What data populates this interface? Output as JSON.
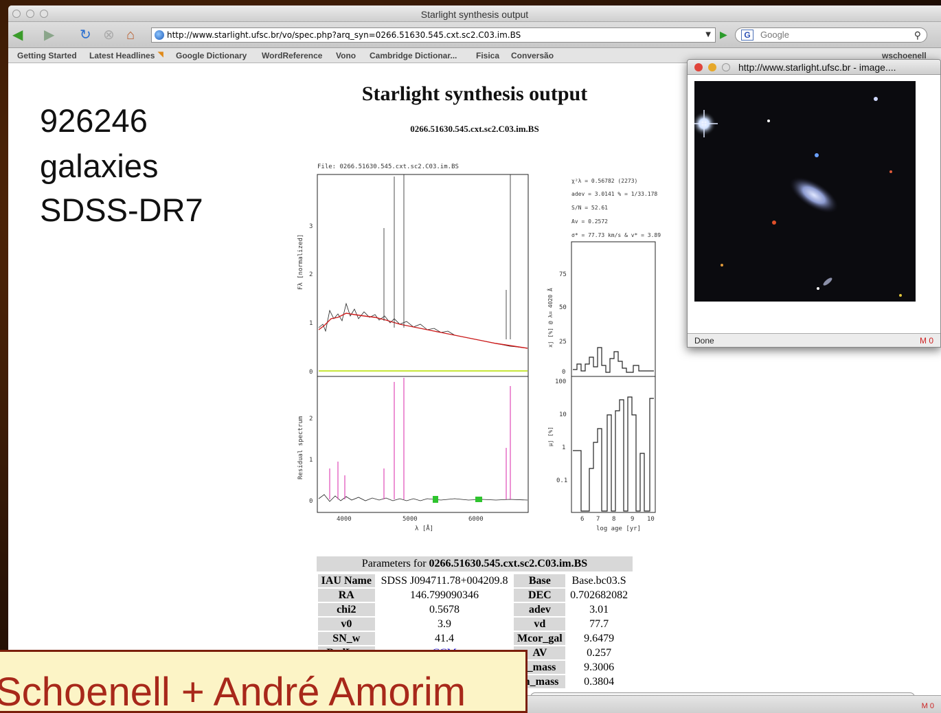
{
  "browser": {
    "window_title": "Starlight synthesis output",
    "url": "http://www.starlight.ufsc.br/vo/spec.php?arq_syn=0266.51630.545.cxt.sc2.C03.im.BS",
    "search_placeholder": "Google",
    "bookmarks": [
      "Getting Started",
      "Latest Headlines",
      "Google Dictionary",
      "WordReference",
      "Vono",
      "Cambridge Dictionar...",
      "Fisica",
      "Conversão"
    ],
    "bookmark_user": "wschoenell"
  },
  "page": {
    "title": "Starlight synthesis output",
    "subtitle": "0266.51630.545.cxt.sc2.C03.im.BS"
  },
  "plot": {
    "file_label": "File: 0266.51630.545.cxt.sc2.C03.im.BS",
    "stats": [
      "χ²λ = 0.56782   (2273)",
      "adev = 3.0141 %  =  1/33.178",
      "S/N = 52.61",
      "Av = 0.2572",
      "σ* = 77.73 km/s  &  v* = 3.89"
    ],
    "spectrum_ylabel": "Fλ [normalized]",
    "residual_ylabel": "Residual spectrum",
    "xlabel": "λ [Å]",
    "x_ticks": [
      "4000",
      "5000",
      "6000"
    ],
    "spectrum_yticks": [
      "0",
      "1",
      "2",
      "3"
    ],
    "residual_yticks": [
      "0",
      "1",
      "2"
    ],
    "light_ylabel": "xj [%] @ λ= 4020 Å",
    "light_yticks": [
      "0",
      "25",
      "50",
      "75"
    ],
    "mass_ylabel": "μj [%]",
    "mass_yticks": [
      "0.1",
      "1",
      "10",
      "100"
    ],
    "age_xlabel": "log age [yr]",
    "age_ticks": [
      "6",
      "7",
      "8",
      "9",
      "10"
    ]
  },
  "params": {
    "header_prefix": "Parameters for ",
    "header_name": "0266.51630.545.cxt.sc2.C03.im.BS",
    "rows": [
      [
        "IAU Name",
        "SDSS J094711.78+004209.8",
        "Base",
        "Base.bc03.S"
      ],
      [
        "RA",
        "146.799090346",
        "DEC",
        "0.702682082"
      ],
      [
        "chi2",
        "0.5678",
        "adev",
        "3.01"
      ],
      [
        "v0",
        "3.9",
        "vd",
        "77.7"
      ],
      [
        "SN_w",
        "41.4",
        "Mcor_gal",
        "9.6479"
      ],
      [
        "RedLaw",
        "CCM",
        "AV",
        "0.257"
      ],
      [
        "",
        "",
        "t_mass",
        "9.3006"
      ],
      [
        "",
        "",
        "m_mass",
        "0.3804"
      ]
    ]
  },
  "popup": {
    "title": "http://www.starlight.ufsc.br - image....",
    "status": "Done",
    "mail_count": "0"
  },
  "status_mail_count": "0",
  "slide": {
    "count": "926246",
    "line2": "galaxies",
    "line3": "SDSS-DR7",
    "authors": "Schoenell + André Amorim"
  }
}
